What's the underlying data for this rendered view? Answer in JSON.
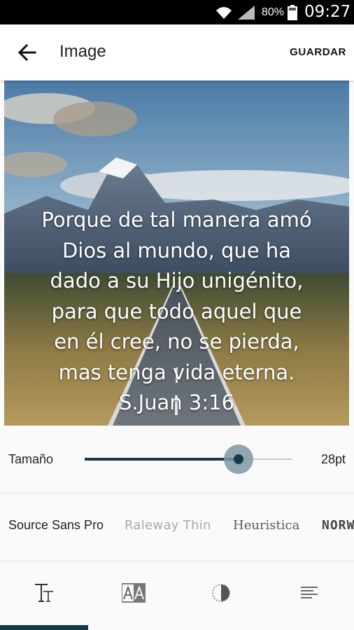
{
  "status_bar": {
    "battery_percent": "80%",
    "time": "09:27",
    "icons": [
      "wifi-icon",
      "signal-icon",
      "battery-icon"
    ]
  },
  "app_bar": {
    "title": "Image",
    "save_label": "GUARDAR",
    "back_icon": "arrow-left-icon"
  },
  "verse": {
    "lines": [
      "Porque de tal manera amó",
      "Dios al mundo, que ha",
      "dado a su Hijo unigénito,",
      "para que todo aquel que",
      "en él cree, no se pierda,",
      "mas tenga vida eterna.",
      "S.Juan 3:16"
    ]
  },
  "size_control": {
    "label": "Tamaño",
    "value_label": "28pt",
    "slider_fraction": 0.74
  },
  "fonts": {
    "options": [
      "Source Sans Pro",
      "Raleway Thin",
      "Heuristica",
      "NORW"
    ]
  },
  "tabs": {
    "items": [
      "text-size-icon",
      "font-icon",
      "contrast-icon",
      "align-icon"
    ],
    "active_index": 0
  },
  "colors": {
    "accent": "#173a4a",
    "slider_halo": "#7d97a3"
  }
}
